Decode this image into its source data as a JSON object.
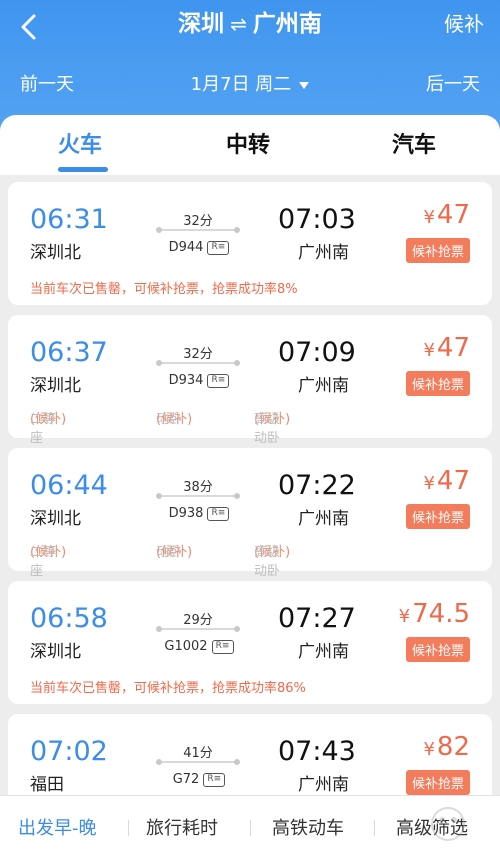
{
  "header": {
    "from": "深圳",
    "swap_symbol": "⇌",
    "to": "广州南",
    "waitlist": "候补"
  },
  "date_bar": {
    "prev": "前一天",
    "date": "1月7日 周二",
    "next": "后一天"
  },
  "tabs": [
    {
      "label": "火车",
      "active": true
    },
    {
      "label": "中转",
      "active": false
    },
    {
      "label": "汽车",
      "active": false
    }
  ],
  "colors": {
    "accent": "#3b8de8",
    "price": "#ef6a4a"
  },
  "trains": [
    {
      "dep_time": "06:31",
      "dep_station": "深圳北",
      "duration": "32分",
      "train_no": "D944",
      "arr_time": "07:03",
      "arr_station": "广州南",
      "price_symbol": "¥",
      "price": "47",
      "action": "候补抢票",
      "note": "当前车次已售罄，可候补抢票，抢票成功率8%"
    },
    {
      "dep_time": "06:37",
      "dep_station": "深圳北",
      "duration": "32分",
      "train_no": "D934",
      "arr_time": "07:09",
      "arr_station": "广州南",
      "price_symbol": "¥",
      "price": "47",
      "action": "候补抢票",
      "seats": [
        {
          "name": "二等座",
          "status": "(候补)"
        },
        {
          "name": "动卧",
          "status": "(候补)"
        },
        {
          "name": "高级动卧",
          "status": "(候补)"
        }
      ]
    },
    {
      "dep_time": "06:44",
      "dep_station": "深圳北",
      "duration": "38分",
      "train_no": "D938",
      "arr_time": "07:22",
      "arr_station": "广州南",
      "price_symbol": "¥",
      "price": "47",
      "action": "候补抢票",
      "seats": [
        {
          "name": "二等座",
          "status": "(候补)"
        },
        {
          "name": "动卧",
          "status": "(候补)"
        },
        {
          "name": "高级动卧",
          "status": "(候补)"
        }
      ]
    },
    {
      "dep_time": "06:58",
      "dep_station": "深圳北",
      "duration": "29分",
      "train_no": "G1002",
      "arr_time": "07:27",
      "arr_station": "广州南",
      "price_symbol": "¥",
      "price": "74.5",
      "action": "候补抢票",
      "note": "当前车次已售罄，可候补抢票，抢票成功率86%"
    },
    {
      "dep_time": "07:02",
      "dep_station": "福田",
      "duration": "41分",
      "train_no": "G72",
      "arr_time": "07:43",
      "arr_station": "广州南",
      "price_symbol": "¥",
      "price": "82",
      "action": "候补抢票"
    }
  ],
  "id_icon_text": "R≡",
  "bottom_bar": [
    {
      "label": "出发早-晚",
      "active": true
    },
    {
      "label": "旅行耗时",
      "active": false
    },
    {
      "label": "高铁动车",
      "active": false
    },
    {
      "label": "高级筛选",
      "active": false
    }
  ]
}
